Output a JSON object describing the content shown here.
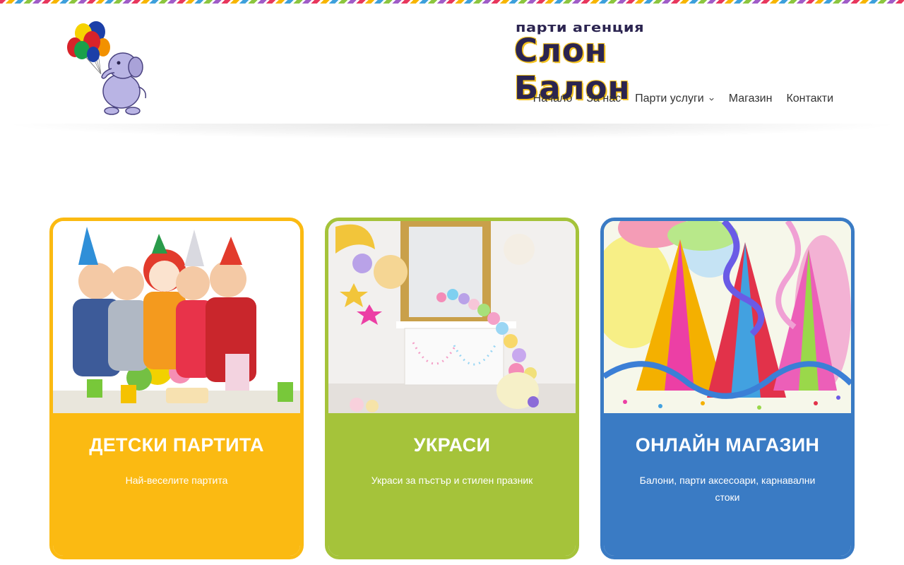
{
  "brand": {
    "tagline": "парти агенция",
    "name": "Слон Балон"
  },
  "nav": {
    "items": [
      {
        "label": "Начало"
      },
      {
        "label": "За нас"
      },
      {
        "label": "Парти услуги"
      },
      {
        "label": "Магазин"
      },
      {
        "label": "Контакти"
      }
    ]
  },
  "cards": [
    {
      "title": "ДЕТСКИ ПАРТИТА",
      "subtitle": "Най-веселите партита",
      "color": "#fbba12"
    },
    {
      "title": "УКРАСИ",
      "subtitle": "Украси за пъстър и стилен празник",
      "color": "#a5c33a"
    },
    {
      "title": "ОНЛАЙН МАГАЗИН",
      "subtitle": "Балони, парти аксесоари, карнавални стоки",
      "color": "#3a7bc4"
    }
  ],
  "icons": {
    "logo": "elephant-with-balloons-icon",
    "dropdown": "chevron-down-icon"
  }
}
